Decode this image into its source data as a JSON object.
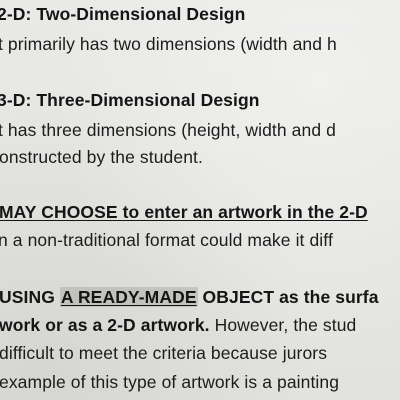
{
  "lines": {
    "l1": "2-D: Two-Dimensional Design",
    "l2": "t primarily has two dimensions (width and h",
    "l3": "3-D: Three-Dimensional Design",
    "l4": "t has three dimensions (height, width and d",
    "l5": "onstructed by the student.",
    "l6": "MAY CHOOSE to enter an artwork in the 2-D",
    "l7": "n a non-traditional format could make it diff",
    "l8a": "USING ",
    "l8b": "A READY-MADE",
    "l8c": " OBJECT as the surfa",
    "l9a": "work or as a 2-D artwork.",
    "l9b": " However, the stud",
    "l10": "difficult to meet the criteria because jurors",
    "l11": "example of this type of artwork is a painting"
  }
}
